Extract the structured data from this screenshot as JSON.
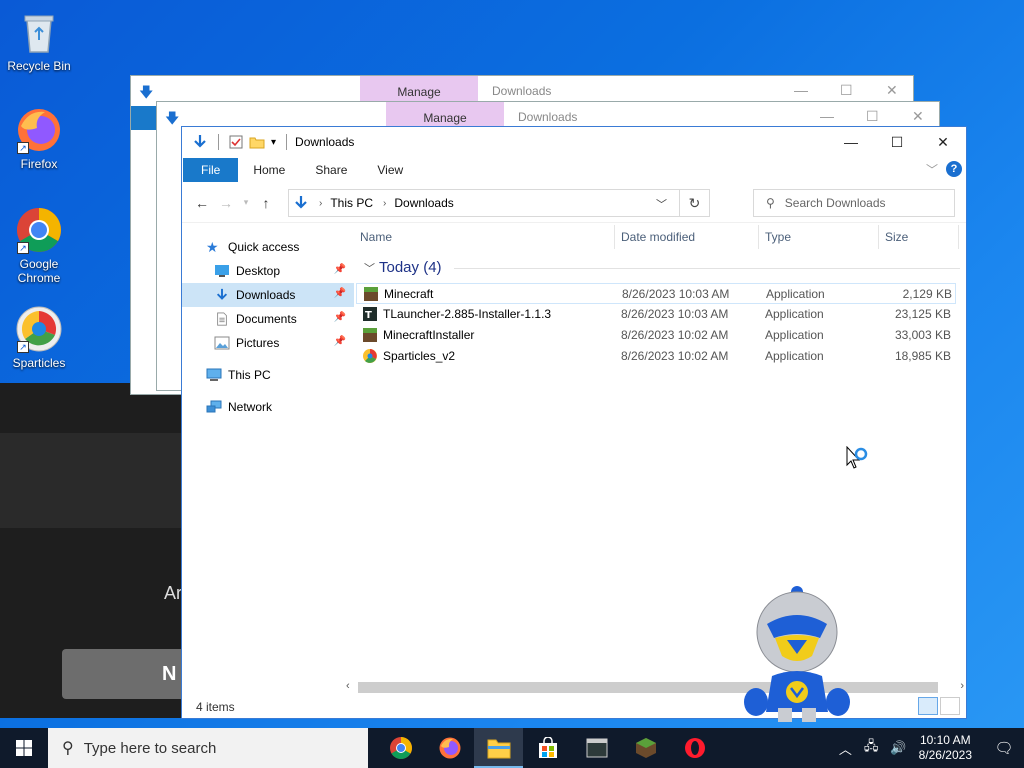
{
  "desktop": {
    "icons": [
      {
        "label": "Recycle Bin"
      },
      {
        "label": "Firefox"
      },
      {
        "label": "Google Chrome"
      },
      {
        "label": "Sparticles"
      }
    ],
    "dark_app": {
      "text_fragment": "Ar",
      "button_fragment": "N"
    }
  },
  "ghost_windows": [
    {
      "manage": "Manage",
      "title": "Downloads"
    },
    {
      "manage": "Manage",
      "title": "Downloads"
    }
  ],
  "explorer": {
    "title": "Downloads",
    "ribbon": {
      "tabs": [
        "File",
        "Home",
        "Share",
        "View"
      ]
    },
    "address": {
      "crumbs": [
        "This PC",
        "Downloads"
      ]
    },
    "search": {
      "placeholder": "Search Downloads"
    },
    "nav": [
      {
        "label": "Quick access"
      },
      {
        "label": "Desktop"
      },
      {
        "label": "Downloads"
      },
      {
        "label": "Documents"
      },
      {
        "label": "Pictures"
      },
      {
        "label": "This PC"
      },
      {
        "label": "Network"
      }
    ],
    "columns": {
      "name": "Name",
      "date": "Date modified",
      "type": "Type",
      "size": "Size"
    },
    "group": "Today (4)",
    "files": [
      {
        "name": "Minecraft",
        "date": "8/26/2023 10:03 AM",
        "type": "Application",
        "size": "2,129 KB"
      },
      {
        "name": "TLauncher-2.885-Installer-1.1.3",
        "date": "8/26/2023 10:03 AM",
        "type": "Application",
        "size": "23,125 KB"
      },
      {
        "name": "MinecraftInstaller",
        "date": "8/26/2023 10:02 AM",
        "type": "Application",
        "size": "33,003 KB"
      },
      {
        "name": "Sparticles_v2",
        "date": "8/26/2023 10:02 AM",
        "type": "Application",
        "size": "18,985 KB"
      }
    ],
    "status": "4 items"
  },
  "taskbar": {
    "search_placeholder": "Type here to search",
    "clock_time": "10:10 AM",
    "clock_date": "8/26/2023"
  }
}
